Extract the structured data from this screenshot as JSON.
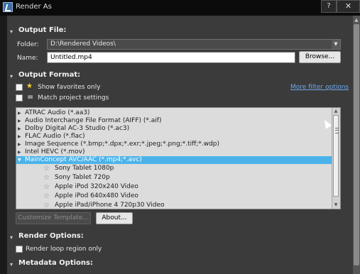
{
  "window": {
    "title": "Render As",
    "help_glyph": "?",
    "close_glyph": "✕"
  },
  "output_file": {
    "title": "Output File:",
    "folder_label": "Folder:",
    "folder_value": "D:\\Rendered Videos\\",
    "name_label": "Name:",
    "name_value": "Untitled.mp4",
    "browse_label": "Browse..."
  },
  "output_format": {
    "title": "Output Format:",
    "show_favorites_label": "Show favorites only",
    "match_project_label": "Match project settings",
    "more_filter_link": "More filter options",
    "formats": [
      {
        "label": "ATRAC Audio (*.aa3)",
        "expanded": false
      },
      {
        "label": "Audio Interchange File Format (AIFF) (*.aif)",
        "expanded": false
      },
      {
        "label": "Dolby Digital AC-3 Studio (*.ac3)",
        "expanded": false
      },
      {
        "label": "FLAC Audio (*.flac)",
        "expanded": false
      },
      {
        "label": "Image Sequence (*.bmp;*.dpx;*.exr;*.jpeg;*.png;*.tiff;*.wdp)",
        "expanded": false
      },
      {
        "label": "Intel HEVC (*.mov)",
        "expanded": false
      },
      {
        "label": "MainConcept AVC/AAC (*.mp4;*.avc)",
        "expanded": true,
        "selected": true
      }
    ],
    "templates": [
      "Sony Tablet 1080p",
      "Sony Tablet 720p",
      "Apple iPod 320x240 Video",
      "Apple iPod 640x480 Video",
      "Apple iPad/iPhone 4 720p30 Video"
    ],
    "customize_label": "Customize Template...",
    "about_label": "About..."
  },
  "render_options": {
    "title": "Render Options:",
    "render_loop_label": "Render loop region only"
  },
  "metadata_options": {
    "title": "Metadata Options:"
  },
  "colors": {
    "selection": "#4cb3ea",
    "link": "#6ea8ea",
    "favorite_star": "#ffd12a"
  }
}
